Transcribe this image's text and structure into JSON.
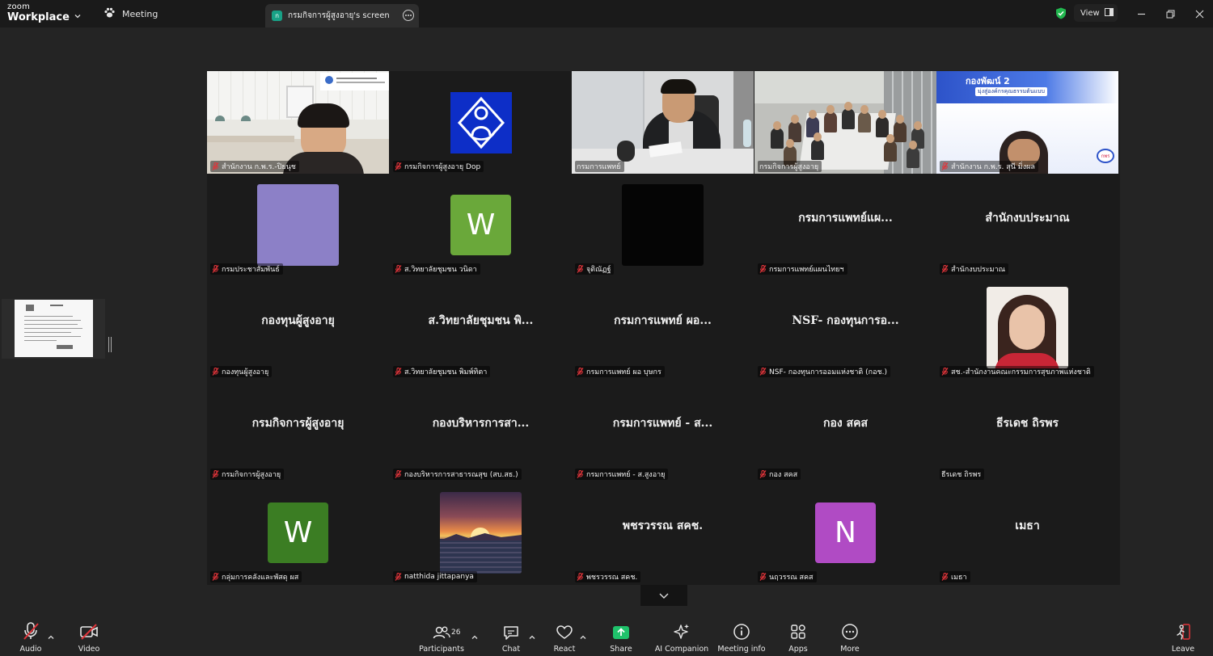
{
  "app": {
    "brand_top": "zoom",
    "brand_bottom": "Workplace",
    "meeting_tab": "Meeting",
    "screen_tab": "กรมกิจการผู้สูงอายุ's screen",
    "screen_tab_avatar": "ก",
    "view_label": "View"
  },
  "colors": {
    "speaking_outline": "#16d27a",
    "share_green": "#1fc26b",
    "mic_off_red": "#e0343a",
    "window_bg": "#242424"
  },
  "tiles": [
    {
      "name": "สำนักงาน ก.พ.ร.-ปิยนุช",
      "muted": true,
      "kind": "video-office"
    },
    {
      "name": "กรมกิจการผู้สูงอายุ Dop",
      "muted": true,
      "kind": "logo-dop"
    },
    {
      "name": "กรมการแพทย์",
      "muted": false,
      "kind": "video-man"
    },
    {
      "name": "กรมกิจการผู้สูงอายุ",
      "muted": false,
      "kind": "video-room",
      "speaking": true
    },
    {
      "name": "สำนักงาน ก.พ.ร. สุนี มิ่งผล",
      "muted": true,
      "kind": "video-banner",
      "banner_title": "กองพัฒน์ 2",
      "banner_sub": "มุ่งสู่องค์กรคุณธรรมต้นแบบ",
      "banner_logo": "กพร"
    },
    {
      "name": "กรมประชาสัมพันธ์",
      "muted": true,
      "kind": "avatar-lavender"
    },
    {
      "name": "ส.วิทยาลัยชุมชน วนิดา",
      "muted": true,
      "kind": "avatar-letter",
      "letter": "W",
      "color": "#6aa83a"
    },
    {
      "name": "จุติณัฏฐ์",
      "muted": true,
      "kind": "avatar-black"
    },
    {
      "name": "กรมการแพทย์แผนไทยฯ",
      "muted": true,
      "kind": "text",
      "display": "กรมการแพทย์แผ..."
    },
    {
      "name": "สำนักงบประมาณ",
      "muted": true,
      "kind": "text",
      "display": "สำนักงบประมาณ"
    },
    {
      "name": "กองทุนผู้สูงอายุ",
      "muted": true,
      "kind": "text",
      "display": "กองทุนผู้สูงอายุ"
    },
    {
      "name": "ส.วิทยาลัยชุมชน พิมพ์ทิตา",
      "muted": true,
      "kind": "text",
      "display": "ส.วิทยาลัยชุมชน พิ..."
    },
    {
      "name": "กรมการแพทย์ ผอ บุษกร",
      "muted": true,
      "kind": "text",
      "display": "กรมการแพทย์ ผอ..."
    },
    {
      "name": "NSF- กองทุนการออมแห่งชาติ (กอช.)",
      "muted": true,
      "kind": "text",
      "display": "NSF- กองทุนการอ..."
    },
    {
      "name": "สช.-สำนักงานคณะกรรมการสุขภาพแห่งชาติ",
      "muted": true,
      "kind": "avatar-photo-woman"
    },
    {
      "name": "กรมกิจการผู้สูงอายุ",
      "muted": true,
      "kind": "text",
      "display": "กรมกิจการผู้สูงอายุ"
    },
    {
      "name": "กองบริหารการสาธารณสุข (สบ.สธ.)",
      "muted": true,
      "kind": "text",
      "display": "กองบริหารการสา..."
    },
    {
      "name": "กรมการแพทย์ - ส.สูงอายุ",
      "muted": true,
      "kind": "text",
      "display": "กรมการแพทย์ - ส..."
    },
    {
      "name": "กอง สคส",
      "muted": true,
      "kind": "text",
      "display": "กอง สคส"
    },
    {
      "name": "ธีรเดช ถิรพร",
      "muted": false,
      "kind": "text",
      "display": "ธีรเดช ถิรพร"
    },
    {
      "name": "กลุ่มการคลังและพัสดุ ผส",
      "muted": true,
      "kind": "avatar-letter",
      "letter": "W",
      "color": "#3b7d23"
    },
    {
      "name": "natthida jittapanya",
      "muted": true,
      "kind": "avatar-sunset"
    },
    {
      "name": "พชรวรรณ สคช.",
      "muted": true,
      "kind": "text",
      "display": "พชรวรรณ สคช."
    },
    {
      "name": "นฤวรรณ สคส",
      "muted": true,
      "kind": "avatar-letter",
      "letter": "N",
      "color": "#b04bc4"
    },
    {
      "name": "เมธา",
      "muted": true,
      "kind": "text",
      "display": "เมธา"
    }
  ],
  "toolbar": {
    "audio": "Audio",
    "video": "Video",
    "participants": "Participants",
    "participants_count": "26",
    "chat": "Chat",
    "react": "React",
    "share": "Share",
    "ai_companion": "AI Companion",
    "meeting_info": "Meeting info",
    "apps": "Apps",
    "more": "More",
    "leave": "Leave"
  }
}
